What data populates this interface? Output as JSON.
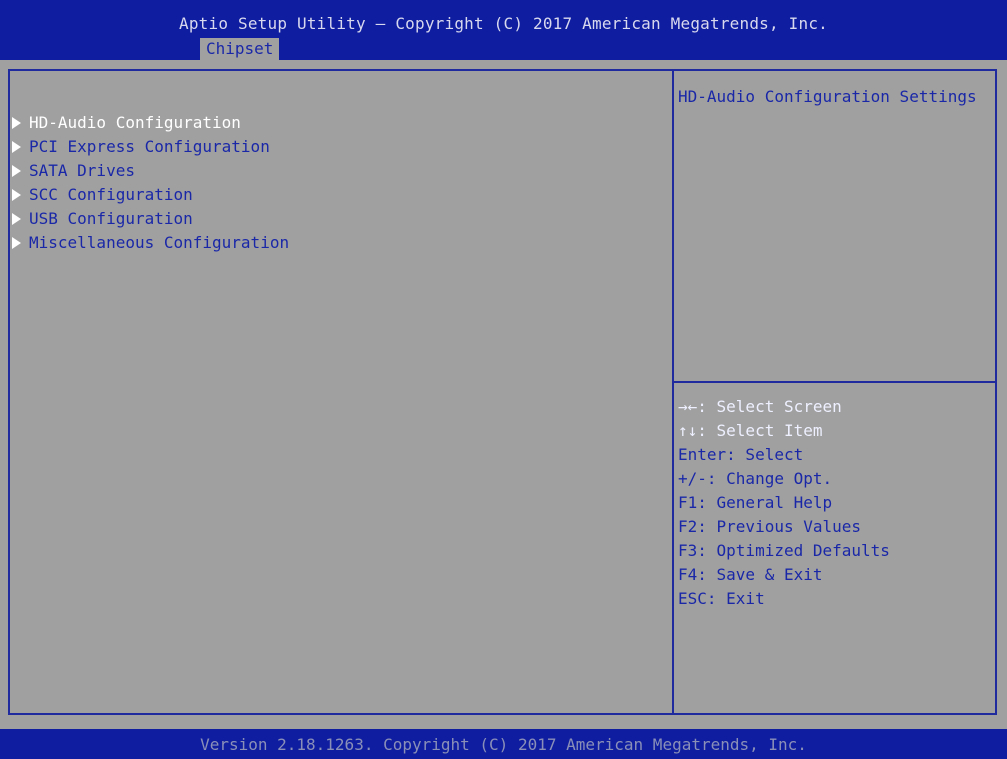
{
  "header": {
    "title": "Aptio Setup Utility – Copyright (C) 2017 American Megatrends, Inc.",
    "active_tab": "Chipset"
  },
  "menu": {
    "items": [
      {
        "label": "HD-Audio Configuration",
        "selected": true
      },
      {
        "label": "PCI Express Configuration",
        "selected": false
      },
      {
        "label": "SATA Drives",
        "selected": false
      },
      {
        "label": "SCC Configuration",
        "selected": false
      },
      {
        "label": "USB Configuration",
        "selected": false
      },
      {
        "label": "Miscellaneous Configuration",
        "selected": false
      }
    ]
  },
  "help": {
    "description": "HD-Audio Configuration Settings"
  },
  "keys": [
    {
      "text": "→←: Select Screen"
    },
    {
      "text": "↑↓: Select Item"
    },
    {
      "text": "Enter: Select"
    },
    {
      "text": "+/-: Change Opt."
    },
    {
      "text": "F1: General Help"
    },
    {
      "text": "F2: Previous Values"
    },
    {
      "text": "F3: Optimized Defaults"
    },
    {
      "text": "F4: Save & Exit"
    },
    {
      "text": "ESC: Exit"
    }
  ],
  "footer": {
    "text": "Version 2.18.1263. Copyright (C) 2017 American Megatrends, Inc."
  },
  "colors": {
    "header_bg": "#0f1ea0",
    "body_bg": "#a0a0a0",
    "text_blue": "#1a28a8",
    "selected_text": "#ffffff"
  }
}
